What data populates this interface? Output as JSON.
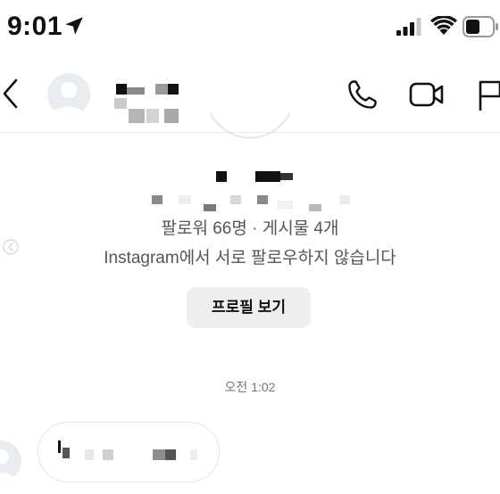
{
  "status_bar": {
    "time": "9:01",
    "location_icon": "location-arrow-icon",
    "signal_icon": "cellular-signal-icon",
    "wifi_icon": "wifi-icon",
    "battery_icon": "battery-icon"
  },
  "header": {
    "back_icon": "chevron-left-icon",
    "avatar_icon": "default-avatar-icon",
    "call_icon": "phone-icon",
    "video_icon": "video-camera-icon",
    "flag_icon": "flag-icon"
  },
  "profile_card": {
    "stats": "팔로워 66명 · 게시물 4개",
    "mutual": "Instagram에서 서로 팔로우하지 않습니다",
    "view_profile_label": "프로필 보기"
  },
  "thread": {
    "timestamp": "오전 1:02"
  },
  "colors": {
    "background": "#ffffff",
    "button_bg": "#efefef",
    "secondary_text": "#555555",
    "divider": "#e6e6e6"
  }
}
